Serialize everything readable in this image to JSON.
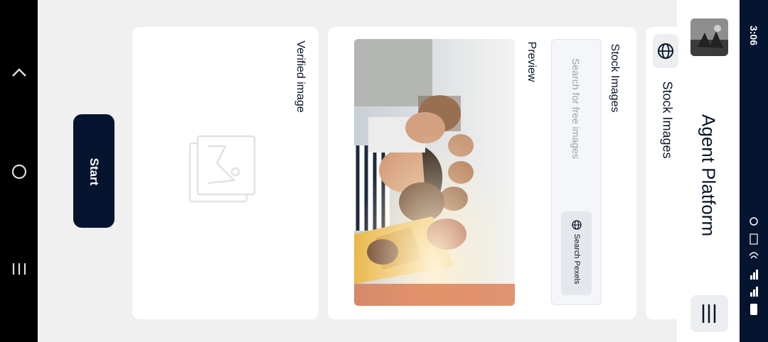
{
  "status": {
    "time": "3:06"
  },
  "header": {
    "title": "Agent Platform"
  },
  "stock_tab": {
    "label": "Stock Images"
  },
  "stock_card": {
    "title": "Stock Images",
    "search": {
      "placeholder": "Search for free images"
    },
    "search_button": "Search Pexels",
    "preview_label": "Preview"
  },
  "verified_card": {
    "title": "Verified image"
  },
  "actions": {
    "start_label": "Start"
  },
  "colors": {
    "navy": "#04142f",
    "card": "#ffffff",
    "bg": "#f0f0f0"
  }
}
